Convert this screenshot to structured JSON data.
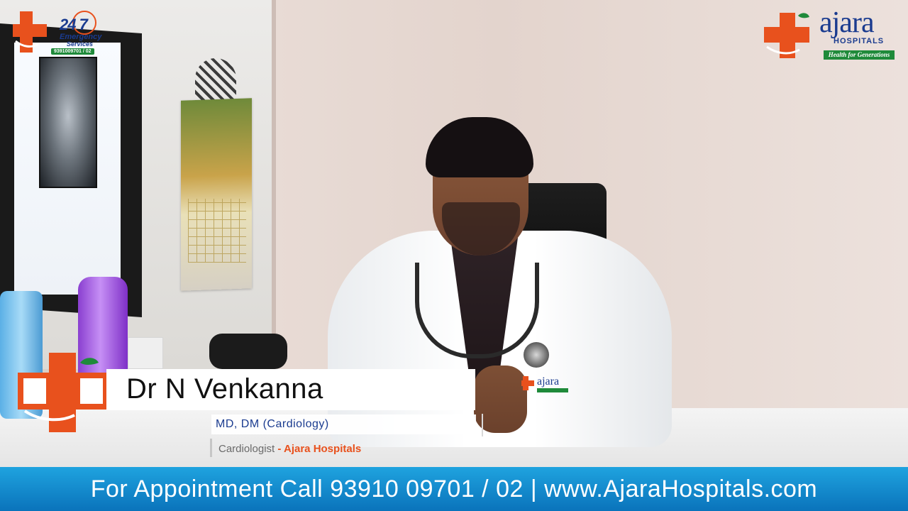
{
  "emergency_badge": {
    "hours": "24 7",
    "line1": "Emergency",
    "line2": "Services",
    "phone": "9391009701 / 02"
  },
  "hospital_logo": {
    "name": "ajara",
    "subtitle": "HOSPITALS",
    "tagline": "Health for Generations"
  },
  "lower_third": {
    "name": "Dr N Venkanna",
    "degree": "MD, DM (Cardiology)",
    "role": "Cardiologist",
    "separator": " - ",
    "organization": "Ajara Hospitals"
  },
  "banner": {
    "prefix": "For Appointment Call ",
    "phone": "93910 09701 / 02",
    "divider": " | ",
    "website": "www.AjaraHospitals.com"
  },
  "colors": {
    "brand_orange": "#e8511d",
    "brand_blue": "#1a3b8f",
    "brand_green": "#1f8a3a",
    "banner_blue": "#0a73bb"
  }
}
